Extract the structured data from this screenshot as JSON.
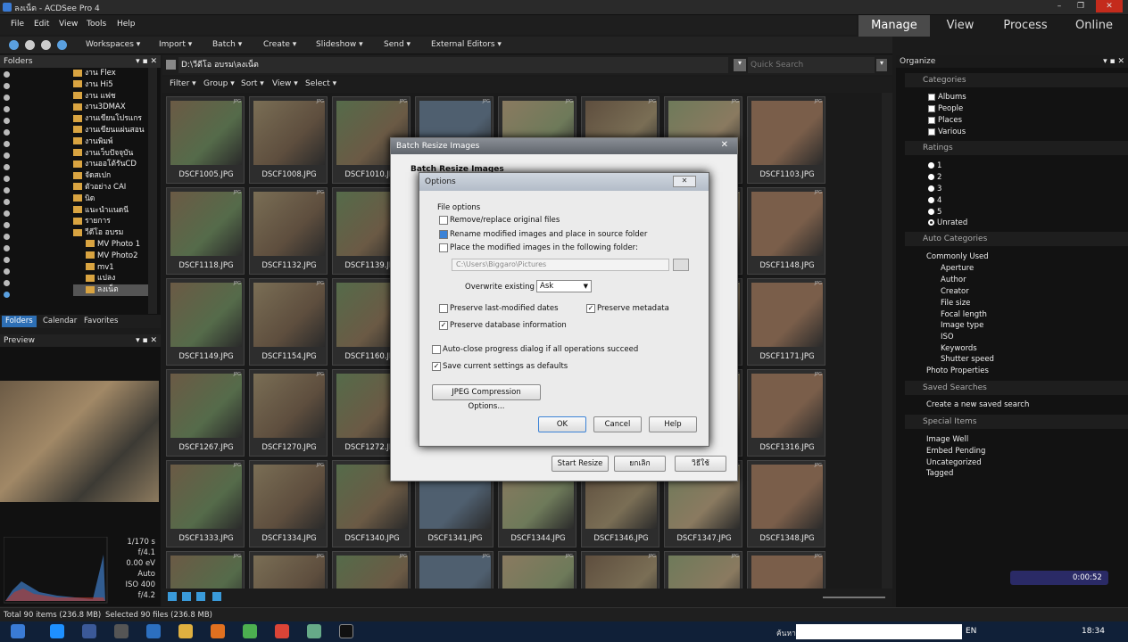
{
  "window": {
    "title": "ลงเน็ต - ACDSee Pro 4",
    "min": "–",
    "max": "❐",
    "close": "✕"
  },
  "menu": [
    "File",
    "Edit",
    "View",
    "Tools",
    "Help"
  ],
  "modes": [
    "Manage",
    "View",
    "Process",
    "Online"
  ],
  "toolbar": [
    "Workspaces ▾",
    "Import ▾",
    "Batch ▾",
    "Create ▾",
    "Slideshow ▾",
    "Send ▾",
    "External Editors ▾"
  ],
  "folders": {
    "title": "Folders",
    "items": [
      "งาน Flex",
      "งาน Hi5",
      "งาน แฟช",
      "งาน3DMAX",
      "งานเขียนโปรแกร",
      "งานเขียนแผ่นสอน",
      "งานพิมพ์",
      "งานเว็บปัจจุบัน",
      "งานออโต้รันCD",
      "จัดสเปก",
      "ตัวอย่าง CAI",
      "นิด",
      "แนะนำแนดนี",
      "รายการ",
      "วีดีโอ อบรม",
      "MV Photo 1",
      "MV Photo2",
      "mv1",
      "แปลง",
      "ลงเน็ต"
    ],
    "tabs": [
      "Folders",
      "Calendar",
      "Favorites"
    ]
  },
  "preview": {
    "title": "Preview",
    "exif": [
      "1/170 s",
      "f/4.1",
      "0.00 eV",
      "Auto",
      "ISO 400",
      "f/4.2"
    ]
  },
  "pathbar": {
    "path": "D:\\วีดีโอ อบรม\\ลงเน็ต",
    "search_placeholder": "Quick Search"
  },
  "subtoolbar": [
    "Filter ▾",
    "Group ▾",
    "Sort ▾",
    "View ▾",
    "Select ▾"
  ],
  "thumbnails": [
    "DSCF1005.JPG",
    "DSCF1008.JPG",
    "DSCF1010.JPG",
    "",
    "",
    "",
    "",
    "DSCF1103.JPG",
    "DSCF1118.JPG",
    "DSCF1132.JPG",
    "DSCF1139.JPG",
    "",
    "",
    "",
    "",
    "DSCF1148.JPG",
    "DSCF1149.JPG",
    "DSCF1154.JPG",
    "DSCF1160.JPG",
    "",
    "",
    "",
    "",
    "DSCF1171.JPG",
    "DSCF1267.JPG",
    "DSCF1270.JPG",
    "DSCF1272.JPG",
    "",
    "",
    "",
    "",
    "DSCF1316.JPG",
    "DSCF1333.JPG",
    "DSCF1334.JPG",
    "DSCF1340.JPG",
    "DSCF1341.JPG",
    "DSCF1344.JPG",
    "DSCF1346.JPG",
    "DSCF1347.JPG",
    "DSCF1348.JPG",
    "",
    "",
    "",
    "",
    "",
    "",
    "",
    ""
  ],
  "thumb_badge": "JPG",
  "organize": {
    "title": "Organize",
    "categories_label": "Categories",
    "categories": [
      "Albums",
      "People",
      "Places",
      "Various"
    ],
    "ratings_label": "Ratings",
    "ratings": [
      "1",
      "2",
      "3",
      "4",
      "5",
      "Unrated"
    ],
    "auto_label": "Auto Categories",
    "commonly_used": "Commonly Used",
    "auto_items": [
      "Aperture",
      "Author",
      "Creator",
      "File size",
      "Focal length",
      "Image type",
      "ISO",
      "Keywords",
      "Shutter speed"
    ],
    "photo_props": "Photo Properties",
    "saved_label": "Saved Searches",
    "saved_new": "Create a new saved search",
    "special_label": "Special Items",
    "special": [
      "Image Well",
      "Embed Pending",
      "Uncategorized",
      "Tagged"
    ]
  },
  "batch_dialog": {
    "title": "Batch Resize Images",
    "heading": "Batch Resize Images",
    "start": "Start Resize",
    "cancel": "ยกเลิก",
    "help": "วิธีใช้"
  },
  "options_dialog": {
    "title": "Options",
    "group": "File options",
    "opt_remove": "Remove/replace original files",
    "opt_rename": "Rename modified images and place in source folder",
    "opt_place": "Place the modified images in the following folder:",
    "folder_path": "C:\\Users\\Biggaro\\Pictures",
    "overwrite_label": "Overwrite existing",
    "overwrite_value": "Ask",
    "preserve_dates": "Preserve last-modified dates",
    "preserve_meta": "Preserve metadata",
    "preserve_db": "Preserve database information",
    "auto_close": "Auto-close progress dialog if all operations succeed",
    "save_defaults": "Save current settings as defaults",
    "jpeg_btn": "JPEG Compression Options...",
    "ok": "OK",
    "cancel": "Cancel",
    "help": "Help"
  },
  "status": {
    "total": "Total 90 items  (236.8 MB)",
    "selected": "Selected 90 files (236.8 MB)"
  },
  "recorder": {
    "time": "0:00:52"
  },
  "taskbar": {
    "lang": "EN",
    "clock": "18:34",
    "search_label": "ค้นหา"
  }
}
